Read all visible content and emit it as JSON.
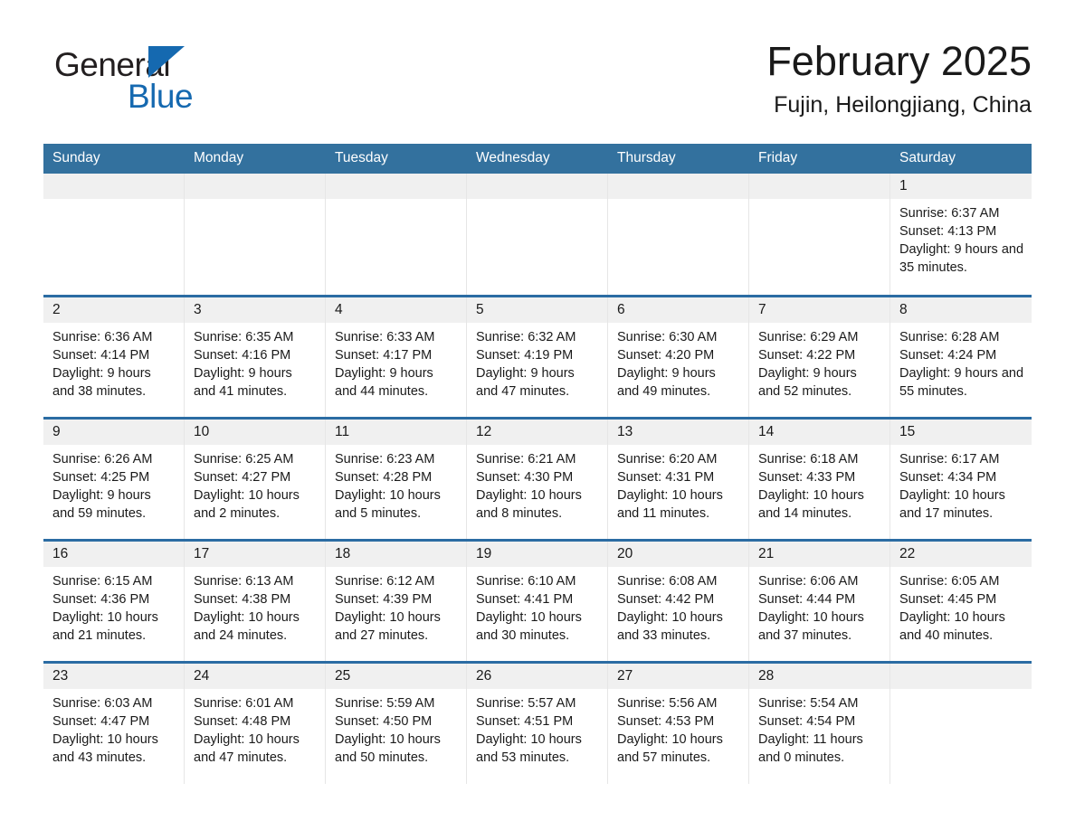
{
  "brand": {
    "word_one": "General",
    "word_two": "Blue",
    "triangle_icon": "triangle-right-icon",
    "accent_color": "#1569b0"
  },
  "header": {
    "title": "February 2025",
    "location": "Fujin, Heilongjiang, China"
  },
  "theme": {
    "header_bg": "#33719e",
    "week_divider": "#2b6ca3",
    "daynum_bg": "#f0f0f0",
    "text": "#1a1a1a"
  },
  "calendar": {
    "weekday_headers": [
      "Sunday",
      "Monday",
      "Tuesday",
      "Wednesday",
      "Thursday",
      "Friday",
      "Saturday"
    ],
    "weeks": [
      [
        {
          "empty": true
        },
        {
          "empty": true
        },
        {
          "empty": true
        },
        {
          "empty": true
        },
        {
          "empty": true
        },
        {
          "empty": true
        },
        {
          "day": "1",
          "sunrise": "Sunrise: 6:37 AM",
          "sunset": "Sunset: 4:13 PM",
          "daylight": "Daylight: 9 hours and 35 minutes."
        }
      ],
      [
        {
          "day": "2",
          "sunrise": "Sunrise: 6:36 AM",
          "sunset": "Sunset: 4:14 PM",
          "daylight": "Daylight: 9 hours and 38 minutes."
        },
        {
          "day": "3",
          "sunrise": "Sunrise: 6:35 AM",
          "sunset": "Sunset: 4:16 PM",
          "daylight": "Daylight: 9 hours and 41 minutes."
        },
        {
          "day": "4",
          "sunrise": "Sunrise: 6:33 AM",
          "sunset": "Sunset: 4:17 PM",
          "daylight": "Daylight: 9 hours and 44 minutes."
        },
        {
          "day": "5",
          "sunrise": "Sunrise: 6:32 AM",
          "sunset": "Sunset: 4:19 PM",
          "daylight": "Daylight: 9 hours and 47 minutes."
        },
        {
          "day": "6",
          "sunrise": "Sunrise: 6:30 AM",
          "sunset": "Sunset: 4:20 PM",
          "daylight": "Daylight: 9 hours and 49 minutes."
        },
        {
          "day": "7",
          "sunrise": "Sunrise: 6:29 AM",
          "sunset": "Sunset: 4:22 PM",
          "daylight": "Daylight: 9 hours and 52 minutes."
        },
        {
          "day": "8",
          "sunrise": "Sunrise: 6:28 AM",
          "sunset": "Sunset: 4:24 PM",
          "daylight": "Daylight: 9 hours and 55 minutes."
        }
      ],
      [
        {
          "day": "9",
          "sunrise": "Sunrise: 6:26 AM",
          "sunset": "Sunset: 4:25 PM",
          "daylight": "Daylight: 9 hours and 59 minutes."
        },
        {
          "day": "10",
          "sunrise": "Sunrise: 6:25 AM",
          "sunset": "Sunset: 4:27 PM",
          "daylight": "Daylight: 10 hours and 2 minutes."
        },
        {
          "day": "11",
          "sunrise": "Sunrise: 6:23 AM",
          "sunset": "Sunset: 4:28 PM",
          "daylight": "Daylight: 10 hours and 5 minutes."
        },
        {
          "day": "12",
          "sunrise": "Sunrise: 6:21 AM",
          "sunset": "Sunset: 4:30 PM",
          "daylight": "Daylight: 10 hours and 8 minutes."
        },
        {
          "day": "13",
          "sunrise": "Sunrise: 6:20 AM",
          "sunset": "Sunset: 4:31 PM",
          "daylight": "Daylight: 10 hours and 11 minutes."
        },
        {
          "day": "14",
          "sunrise": "Sunrise: 6:18 AM",
          "sunset": "Sunset: 4:33 PM",
          "daylight": "Daylight: 10 hours and 14 minutes."
        },
        {
          "day": "15",
          "sunrise": "Sunrise: 6:17 AM",
          "sunset": "Sunset: 4:34 PM",
          "daylight": "Daylight: 10 hours and 17 minutes."
        }
      ],
      [
        {
          "day": "16",
          "sunrise": "Sunrise: 6:15 AM",
          "sunset": "Sunset: 4:36 PM",
          "daylight": "Daylight: 10 hours and 21 minutes."
        },
        {
          "day": "17",
          "sunrise": "Sunrise: 6:13 AM",
          "sunset": "Sunset: 4:38 PM",
          "daylight": "Daylight: 10 hours and 24 minutes."
        },
        {
          "day": "18",
          "sunrise": "Sunrise: 6:12 AM",
          "sunset": "Sunset: 4:39 PM",
          "daylight": "Daylight: 10 hours and 27 minutes."
        },
        {
          "day": "19",
          "sunrise": "Sunrise: 6:10 AM",
          "sunset": "Sunset: 4:41 PM",
          "daylight": "Daylight: 10 hours and 30 minutes."
        },
        {
          "day": "20",
          "sunrise": "Sunrise: 6:08 AM",
          "sunset": "Sunset: 4:42 PM",
          "daylight": "Daylight: 10 hours and 33 minutes."
        },
        {
          "day": "21",
          "sunrise": "Sunrise: 6:06 AM",
          "sunset": "Sunset: 4:44 PM",
          "daylight": "Daylight: 10 hours and 37 minutes."
        },
        {
          "day": "22",
          "sunrise": "Sunrise: 6:05 AM",
          "sunset": "Sunset: 4:45 PM",
          "daylight": "Daylight: 10 hours and 40 minutes."
        }
      ],
      [
        {
          "day": "23",
          "sunrise": "Sunrise: 6:03 AM",
          "sunset": "Sunset: 4:47 PM",
          "daylight": "Daylight: 10 hours and 43 minutes."
        },
        {
          "day": "24",
          "sunrise": "Sunrise: 6:01 AM",
          "sunset": "Sunset: 4:48 PM",
          "daylight": "Daylight: 10 hours and 47 minutes."
        },
        {
          "day": "25",
          "sunrise": "Sunrise: 5:59 AM",
          "sunset": "Sunset: 4:50 PM",
          "daylight": "Daylight: 10 hours and 50 minutes."
        },
        {
          "day": "26",
          "sunrise": "Sunrise: 5:57 AM",
          "sunset": "Sunset: 4:51 PM",
          "daylight": "Daylight: 10 hours and 53 minutes."
        },
        {
          "day": "27",
          "sunrise": "Sunrise: 5:56 AM",
          "sunset": "Sunset: 4:53 PM",
          "daylight": "Daylight: 10 hours and 57 minutes."
        },
        {
          "day": "28",
          "sunrise": "Sunrise: 5:54 AM",
          "sunset": "Sunset: 4:54 PM",
          "daylight": "Daylight: 11 hours and 0 minutes."
        },
        {
          "empty": true
        }
      ]
    ]
  }
}
